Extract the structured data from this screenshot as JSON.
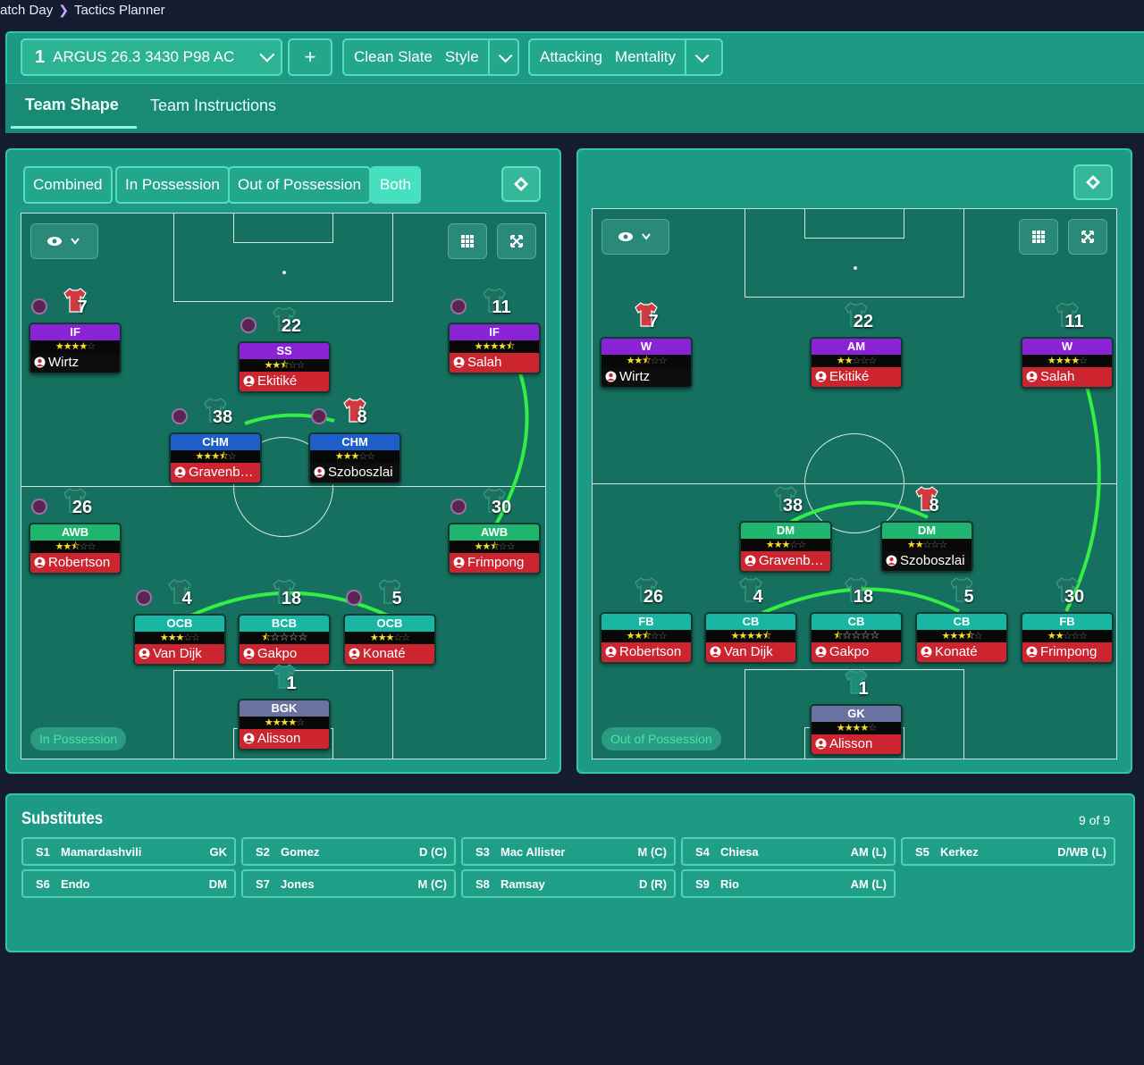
{
  "breadcrumb": {
    "parent": "atch Day",
    "current": "Tactics Planner"
  },
  "tactic": {
    "slot": "1",
    "name": "ARGUS 26.3 3430 P98 AC",
    "add_label": "+",
    "style_value": "Clean Slate",
    "style_label": "Style",
    "mentality_value": "Attacking",
    "mentality_label": "Mentality"
  },
  "tabs": {
    "team_shape": "Team Shape",
    "team_instructions": "Team Instructions"
  },
  "phase_buttons": {
    "combined": "Combined",
    "in_possession": "In Possession",
    "out_of_possession": "Out of Possession",
    "both": "Both"
  },
  "left_pitch": {
    "badge": "In Possession",
    "players": [
      {
        "id": "wirtz",
        "num": "7",
        "role": "IF",
        "stars": 4,
        "name": "Wirtz"
      },
      {
        "id": "ekitike",
        "num": "22",
        "role": "SS",
        "stars": 2.5,
        "name": "Ekitiké"
      },
      {
        "id": "salah",
        "num": "11",
        "role": "IF",
        "stars": 4.5,
        "name": "Salah"
      },
      {
        "id": "gravenberch",
        "num": "38",
        "role": "CHM",
        "stars": 3.5,
        "name": "Gravenber..."
      },
      {
        "id": "szoboszlai",
        "num": "8",
        "role": "CHM",
        "stars": 3,
        "name": "Szoboszlai"
      },
      {
        "id": "robertson",
        "num": "26",
        "role": "AWB",
        "stars": 2.5,
        "name": "Robertson"
      },
      {
        "id": "frimpong",
        "num": "30",
        "role": "AWB",
        "stars": 2.5,
        "name": "Frimpong"
      },
      {
        "id": "vandijk",
        "num": "4",
        "role": "OCB",
        "stars": 3,
        "name": "Van Dijk"
      },
      {
        "id": "gakpo",
        "num": "18",
        "role": "BCB",
        "stars": 0.5,
        "name": "Gakpo"
      },
      {
        "id": "konate",
        "num": "5",
        "role": "OCB",
        "stars": 3,
        "name": "Konaté"
      },
      {
        "id": "alisson",
        "num": "1",
        "role": "BGK",
        "stars": 4,
        "name": "Alisson"
      }
    ]
  },
  "right_pitch": {
    "badge": "Out of Possession",
    "players": [
      {
        "id": "wirtz",
        "num": "7",
        "role": "W",
        "stars": 2.5,
        "name": "Wirtz"
      },
      {
        "id": "ekitike",
        "num": "22",
        "role": "AM",
        "stars": 2,
        "name": "Ekitiké"
      },
      {
        "id": "salah",
        "num": "11",
        "role": "W",
        "stars": 4,
        "name": "Salah"
      },
      {
        "id": "gravenberch",
        "num": "38",
        "role": "DM",
        "stars": 3,
        "name": "Gravenber..."
      },
      {
        "id": "szoboszlai",
        "num": "8",
        "role": "DM",
        "stars": 2,
        "name": "Szoboszlai"
      },
      {
        "id": "robertson",
        "num": "26",
        "role": "FB",
        "stars": 2.5,
        "name": "Robertson"
      },
      {
        "id": "vandijk",
        "num": "4",
        "role": "CB",
        "stars": 4.5,
        "name": "Van Dijk"
      },
      {
        "id": "gakpo",
        "num": "18",
        "role": "CB",
        "stars": 0.5,
        "name": "Gakpo"
      },
      {
        "id": "konate",
        "num": "5",
        "role": "CB",
        "stars": 3.5,
        "name": "Konaté"
      },
      {
        "id": "frimpong",
        "num": "30",
        "role": "FB",
        "stars": 2,
        "name": "Frimpong"
      },
      {
        "id": "alisson",
        "num": "1",
        "role": "GK",
        "stars": 4,
        "name": "Alisson"
      }
    ]
  },
  "substitutes": {
    "title": "Substitutes",
    "count": "9 of 9",
    "items": [
      {
        "slot": "S1",
        "name": "Mamardashvili",
        "pos": "GK"
      },
      {
        "slot": "S2",
        "name": "Gomez",
        "pos": "D (C)"
      },
      {
        "slot": "S3",
        "name": "Mac Allister",
        "pos": "M (C)"
      },
      {
        "slot": "S4",
        "name": "Chiesa",
        "pos": "AM (L)"
      },
      {
        "slot": "S5",
        "name": "Kerkez",
        "pos": "D/WB (L)"
      },
      {
        "slot": "S6",
        "name": "Endo",
        "pos": "DM"
      },
      {
        "slot": "S7",
        "name": "Jones",
        "pos": "M (C)"
      },
      {
        "slot": "S8",
        "name": "Ramsay",
        "pos": "D (R)"
      },
      {
        "slot": "S9",
        "name": "Rio",
        "pos": "AM (L)"
      }
    ]
  },
  "colors": {
    "panel": "#1c9a83",
    "pitch": "#16705f",
    "link_line": "#33ee44"
  }
}
